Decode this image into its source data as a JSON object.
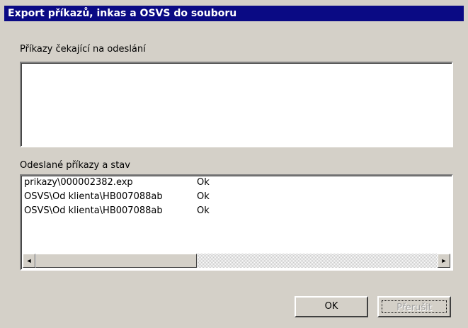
{
  "window": {
    "title": "Export příkazů, inkas a OSVS do souboru"
  },
  "pending": {
    "label": "Příkazy čekající na odeslání",
    "items": []
  },
  "sent": {
    "label": "Odeslané příkazy a stav",
    "rows": [
      {
        "path": "prikazy\\000002382.exp",
        "status": "Ok"
      },
      {
        "path": "OSVS\\Od klienta\\HB007088ab",
        "status": "Ok"
      },
      {
        "path": "OSVS\\Od klienta\\HB007088ab",
        "status": "Ok"
      }
    ]
  },
  "scrollbar": {
    "left_arrow": "◄",
    "right_arrow": "►"
  },
  "buttons": {
    "ok": "OK",
    "cancel": "Přerušit"
  },
  "colors": {
    "titlebar": "#0a0a84",
    "face": "#d4d0c8"
  }
}
